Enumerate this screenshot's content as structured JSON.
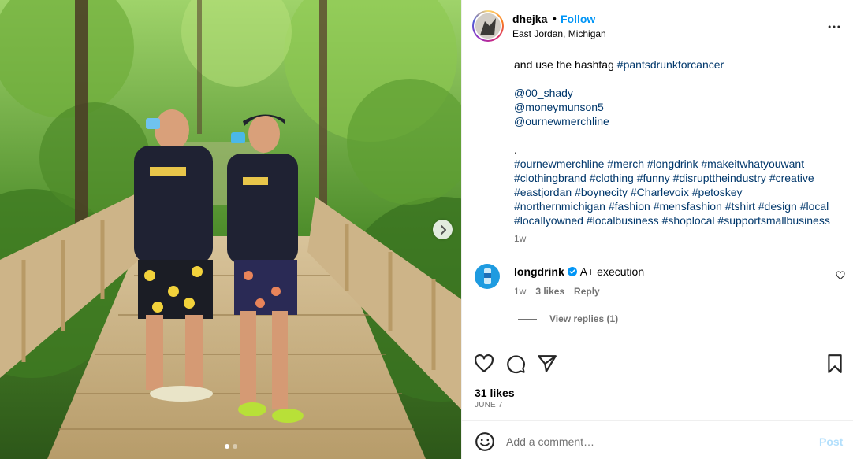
{
  "post": {
    "username": "dhejka",
    "separator": "•",
    "follow_label": "Follow",
    "location": "East Jordan, Michigan",
    "more_icon": "more-horizontal-icon"
  },
  "media": {
    "next_icon": "chevron-right-icon",
    "slide_count": 2,
    "active_slide": 1
  },
  "caption": {
    "line1_text": "and use the hashtag ",
    "line1_tag": "#pantsdrunkforcancer",
    "mentions": [
      "@00_shady",
      "@moneymunson5",
      "@ournewmerchline"
    ],
    "dot": ".",
    "hashtag_lines": [
      [
        "#ournewmerchline",
        "#merch",
        "#longdrink",
        "#makeitwhatyouwant"
      ],
      [
        "#clothingbrand",
        "#clothing",
        "#funny",
        "#disrupttheindustry",
        "#creative"
      ],
      [
        "#eastjordan",
        "#boynecity",
        "#Charlevoix",
        "#petoskey"
      ],
      [
        "#northernmichigan",
        "#fashion",
        "#mensfashion",
        "#tshirt",
        "#design",
        "#local"
      ],
      [
        "#locallyowned",
        "#localbusiness",
        "#shoplocal",
        "#supportsmallbusiness"
      ]
    ],
    "time": "1w"
  },
  "comment": {
    "username": "longdrink",
    "verified_icon": "verified-badge-icon",
    "text": "A+ execution",
    "time": "1w",
    "likes": "3 likes",
    "reply_label": "Reply",
    "view_replies": "View replies (1)"
  },
  "actions": {
    "like_icon": "heart-icon",
    "comment_icon": "comment-icon",
    "share_icon": "send-icon",
    "save_icon": "bookmark-icon",
    "likes": "31 likes",
    "date": "JUNE 7"
  },
  "add_comment": {
    "emoji_icon": "emoji-icon",
    "placeholder": "Add a comment…",
    "post_label": "Post"
  },
  "colors": {
    "link": "#0095f6",
    "hashtag": "#00376b",
    "muted": "#737373",
    "post_disabled": "#b2dffc"
  }
}
